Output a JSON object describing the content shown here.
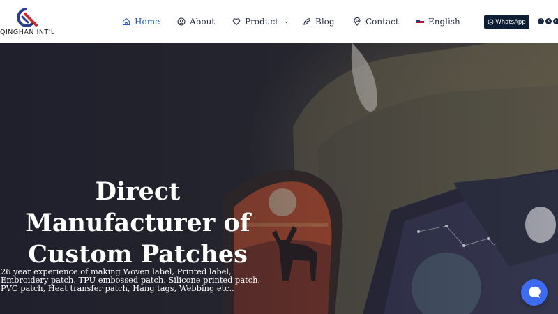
{
  "brand": {
    "name": "QINGHAN INT'L"
  },
  "nav": {
    "items": [
      {
        "label": "Home",
        "icon": "home-icon",
        "active": true
      },
      {
        "label": "About",
        "icon": "user-circle-icon"
      },
      {
        "label": "Product",
        "icon": "heart-icon",
        "has_dropdown": true
      },
      {
        "label": "Blog",
        "icon": "feather-icon"
      },
      {
        "label": "Contact",
        "icon": "location-pin-icon"
      },
      {
        "label": "English",
        "icon": "us-flag-icon"
      }
    ],
    "dropdown_glyph": "⌄"
  },
  "header": {
    "whatsapp_label": "WhatsApp",
    "socials": [
      "f",
      "X",
      "o"
    ]
  },
  "hero": {
    "title_lines": [
      "Direct",
      "Manufacturer of",
      "Custom Patches"
    ],
    "subtitle": "26 year experience of making Woven label, Printed label, Embroidery patch, TPU embossed patch, Silicone printed patch, PVC patch, Heat transfer patch, Hang tags, Webbing etc.."
  },
  "colors": {
    "nav_active": "#2c5fb8",
    "nav_text": "#2a2f45",
    "whatsapp_bg": "#0e1f33",
    "chat_button": "#3d6cf0"
  }
}
